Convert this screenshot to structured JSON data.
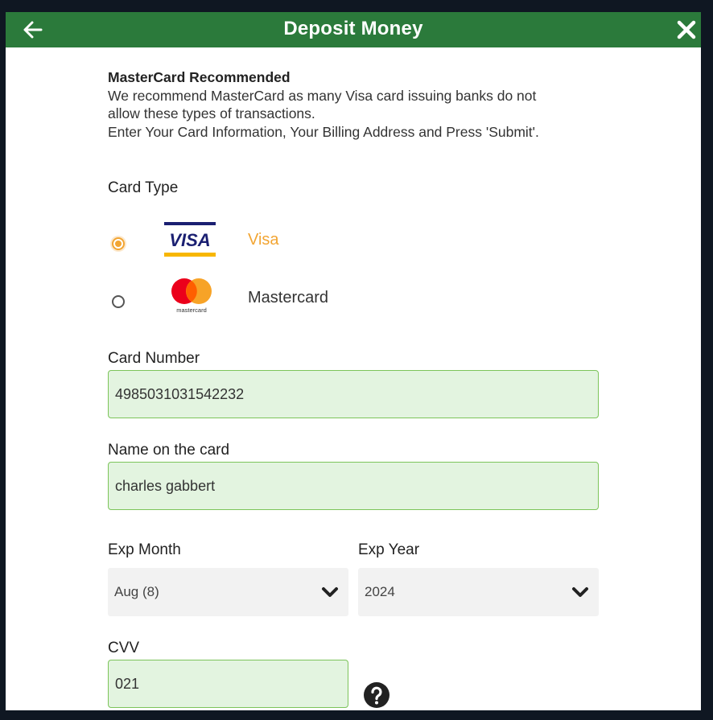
{
  "header": {
    "title": "Deposit Money"
  },
  "notice": {
    "heading": "MasterCard Recommended",
    "line1": "We recommend MasterCard as many Visa card issuing banks do not",
    "line2": "allow these types of transactions.",
    "line3": "Enter Your Card Information, Your Billing Address and Press 'Submit'."
  },
  "card_type": {
    "label": "Card Type",
    "options": [
      {
        "label": "Visa",
        "logo_text": "VISA",
        "selected": true
      },
      {
        "label": "Mastercard",
        "logo_text": "mastercard",
        "selected": false
      }
    ]
  },
  "card_number": {
    "label": "Card Number",
    "value": "4985031031542232"
  },
  "name_on_card": {
    "label": "Name on the card",
    "value": "charles gabbert"
  },
  "exp_month": {
    "label": "Exp Month",
    "value": "Aug (8)"
  },
  "exp_year": {
    "label": "Exp Year",
    "value": "2024"
  },
  "cvv": {
    "label": "CVV",
    "value": "021"
  },
  "colors": {
    "header_green": "#2b7a3b",
    "accent_orange": "#f2a533",
    "field_bg": "#e3f4e0",
    "field_border": "#7cc45a",
    "visa_blue": "#1a1f71",
    "visa_gold": "#f7b600",
    "mc_red": "#eb001b",
    "mc_orange": "#f79e1b"
  },
  "icons": {
    "back": "back-arrow-icon",
    "close": "close-icon",
    "chevron": "chevron-down-icon",
    "help": "help-question-icon"
  }
}
